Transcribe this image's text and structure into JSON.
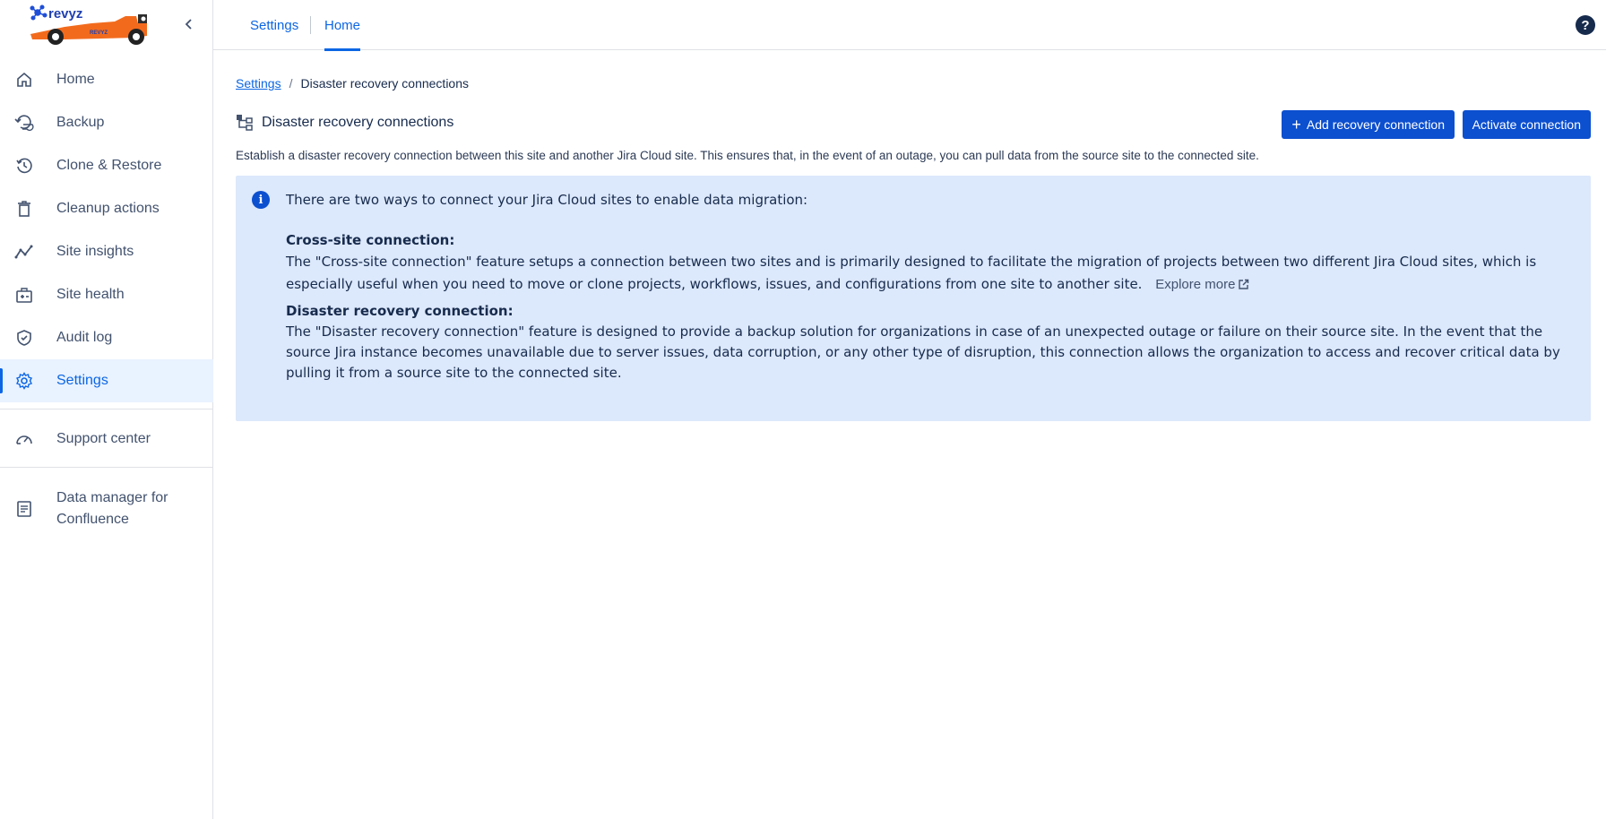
{
  "app": {
    "brand": "revyz",
    "colors": {
      "accent": "#0c66e4",
      "button": "#0c4fcf",
      "info_bg": "#dce8fb",
      "logo_orange": "#f26b1d"
    }
  },
  "sidebar": {
    "items": [
      {
        "label": "Home",
        "icon": "home-icon"
      },
      {
        "label": "Backup",
        "icon": "backup-icon"
      },
      {
        "label": "Clone & Restore",
        "icon": "history-icon"
      },
      {
        "label": "Cleanup actions",
        "icon": "trash-icon"
      },
      {
        "label": "Site insights",
        "icon": "line-chart-icon"
      },
      {
        "label": "Site health",
        "icon": "medical-kit-icon"
      },
      {
        "label": "Audit log",
        "icon": "shield-check-icon"
      },
      {
        "label": "Settings",
        "icon": "gear-icon",
        "active": true
      }
    ],
    "support": {
      "label": "Support center",
      "icon": "speedometer-icon"
    },
    "data_manager": {
      "line1": "Data manager for",
      "line2": "Confluence",
      "icon": "document-list-icon"
    }
  },
  "topbar": {
    "tabs": [
      {
        "label": "Settings"
      },
      {
        "label": "Home",
        "active": true
      }
    ],
    "help_label": "?"
  },
  "main": {
    "breadcrumb": {
      "parent": "Settings",
      "separator": "/",
      "current": "Disaster recovery connections"
    },
    "title": "Disaster recovery connections",
    "buttons": {
      "add": "Add recovery connection",
      "add_prefix": "+",
      "activate": "Activate connection"
    },
    "description": "Establish a disaster recovery connection between this site and another Jira Cloud site. This ensures that, in the event of an outage, you can pull data from the source site to the connected site.",
    "info": {
      "intro": "There are two ways to connect your Jira Cloud sites to enable data migration:",
      "cross_site_heading": "Cross-site connection:",
      "cross_site_text": "The \"Cross-site connection\" feature setups a connection between two sites and is primarily designed to facilitate the migration of projects between two different Jira Cloud sites, which is especially useful when you need to move or clone projects, workflows, issues, and configurations from one site to another site.",
      "explore_more": "Explore more",
      "dr_heading": "Disaster recovery connection:",
      "dr_text": "The \"Disaster recovery connection\" feature is designed to provide a backup solution for organizations in case of an unexpected outage or failure on their source site. In the event that the source Jira instance becomes unavailable due to server issues, data corruption, or any other type of disruption, this connection allows the organization to access and recover critical data by pulling it from a source site to the connected site."
    }
  }
}
